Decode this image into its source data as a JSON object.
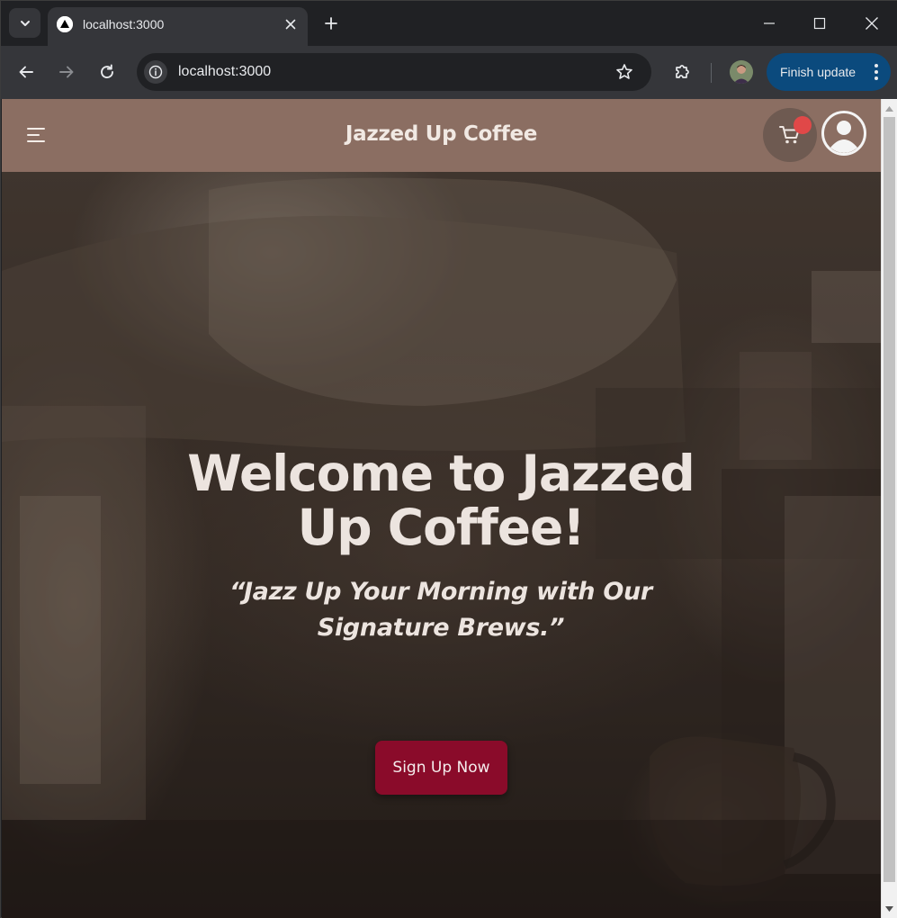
{
  "browser": {
    "tab_title": "localhost:3000",
    "url": "localhost:3000",
    "finish_update_label": "Finish update"
  },
  "site": {
    "brand": "Jazzed Up Coffee",
    "hero": {
      "title": "Welcome to Jazzed Up Coffee!",
      "tagline": "“Jazz Up Your Morning with Our Signature Brews.”",
      "cta_label": "Sign Up Now"
    }
  },
  "colors": {
    "header_bg": "#8b6e62",
    "cta_bg": "#8a0b2a",
    "cart_badge": "#e04848"
  },
  "icons": [
    "tab-search-icon",
    "nextjs-favicon",
    "close-icon",
    "plus-icon",
    "minimize-icon",
    "maximize-icon",
    "window-close-icon",
    "back-arrow-icon",
    "forward-arrow-icon",
    "reload-icon",
    "site-info-icon",
    "star-icon",
    "extensions-icon",
    "profile-avatar",
    "more-vert-icon",
    "hamburger-icon",
    "cart-icon",
    "user-avatar-icon"
  ]
}
